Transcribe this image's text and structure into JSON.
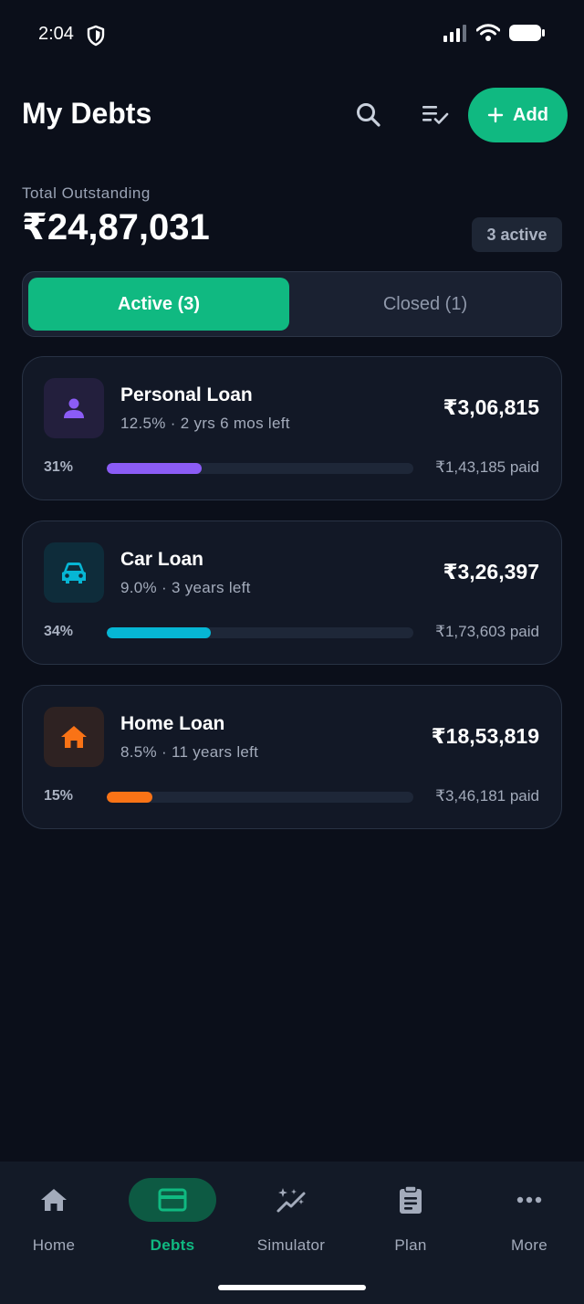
{
  "status_bar": {
    "time": "2:04"
  },
  "header": {
    "title": "My Debts",
    "add_label": "Add",
    "accent": "#10b981"
  },
  "summary": {
    "total_label": "Total Outstanding",
    "total_value": "₹24,87,031",
    "active_badge": "3 active"
  },
  "tabs": {
    "active_label": "Active (3)",
    "closed_label": "Closed (1)"
  },
  "loans": [
    {
      "name": "Personal Loan",
      "subtitle": "12.5% · 2 yrs 6 mos left",
      "amount": "₹3,06,815",
      "progress_label": "31%",
      "progress": 0.31,
      "paid": "₹1,43,185 paid",
      "icon": "person-icon",
      "color": "#8b5cf6",
      "icon_bg": "#231f3d"
    },
    {
      "name": "Car Loan",
      "subtitle": "9.0% · 3 years left",
      "amount": "₹3,26,397",
      "progress_label": "34%",
      "progress": 0.34,
      "paid": "₹1,73,603 paid",
      "icon": "car-icon",
      "color": "#06b6d4",
      "icon_bg": "#0e2c3a"
    },
    {
      "name": "Home Loan",
      "subtitle": "8.5% · 11 years left",
      "amount": "₹18,53,819",
      "progress_label": "15%",
      "progress": 0.15,
      "paid": "₹3,46,181 paid",
      "icon": "house-icon",
      "color": "#f97316",
      "icon_bg": "#2e2222"
    }
  ],
  "nav": {
    "items": [
      {
        "label": "Home",
        "icon": "home-icon"
      },
      {
        "label": "Debts",
        "icon": "card-icon",
        "active": true
      },
      {
        "label": "Simulator",
        "icon": "sparkle-chart-icon"
      },
      {
        "label": "Plan",
        "icon": "clipboard-icon"
      },
      {
        "label": "More",
        "icon": "more-icon"
      }
    ]
  }
}
